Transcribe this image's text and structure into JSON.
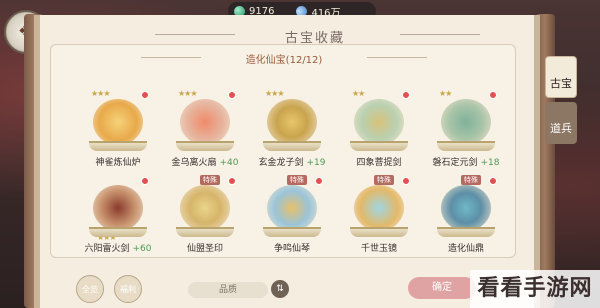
{
  "currency": {
    "jade_amount": "9176",
    "spirit_amount": "416万"
  },
  "panel": {
    "title": "古宝收藏",
    "section_title": "造化仙宝(12/12)"
  },
  "side_tabs": [
    {
      "label": "古宝"
    },
    {
      "label": "道兵"
    }
  ],
  "items": [
    {
      "name": "神雀炼仙炉",
      "stars": "★★★",
      "bonus": "",
      "tag": "",
      "dot": true
    },
    {
      "name": "金乌离火扇",
      "stars": "★★★",
      "bonus": "+40",
      "tag": "",
      "dot": true
    },
    {
      "name": "玄金龙子剑",
      "stars": "★★★",
      "bonus": "+19",
      "tag": "",
      "dot": false
    },
    {
      "name": "四象菩提剑",
      "stars": "★★",
      "bonus": "",
      "tag": "",
      "dot": true
    },
    {
      "name": "磐石定元剑",
      "stars": "★★",
      "bonus": "+18",
      "tag": "",
      "dot": true
    },
    {
      "name": "六阳雷火剑",
      "stars": "★★★",
      "bonus": "+60",
      "tag": "",
      "dot": true
    },
    {
      "name": "仙盟圣印",
      "stars": "",
      "bonus": "",
      "tag": "特殊",
      "dot": true
    },
    {
      "name": "争鸣仙琴",
      "stars": "",
      "bonus": "",
      "tag": "特殊",
      "dot": true
    },
    {
      "name": "千世玉镜",
      "stars": "",
      "bonus": "",
      "tag": "特殊",
      "dot": true
    },
    {
      "name": "造化仙鼎",
      "stars": "",
      "bonus": "",
      "tag": "特殊",
      "dot": true
    }
  ],
  "bottom": {
    "btn1": "全览",
    "btn2": "福利",
    "select": "品质",
    "confirm": "确定"
  },
  "watermark": "看看手游网",
  "colors": {
    "panel": "#f4ede0",
    "accent_red": "#e35050",
    "gold": "#c8a64a"
  }
}
